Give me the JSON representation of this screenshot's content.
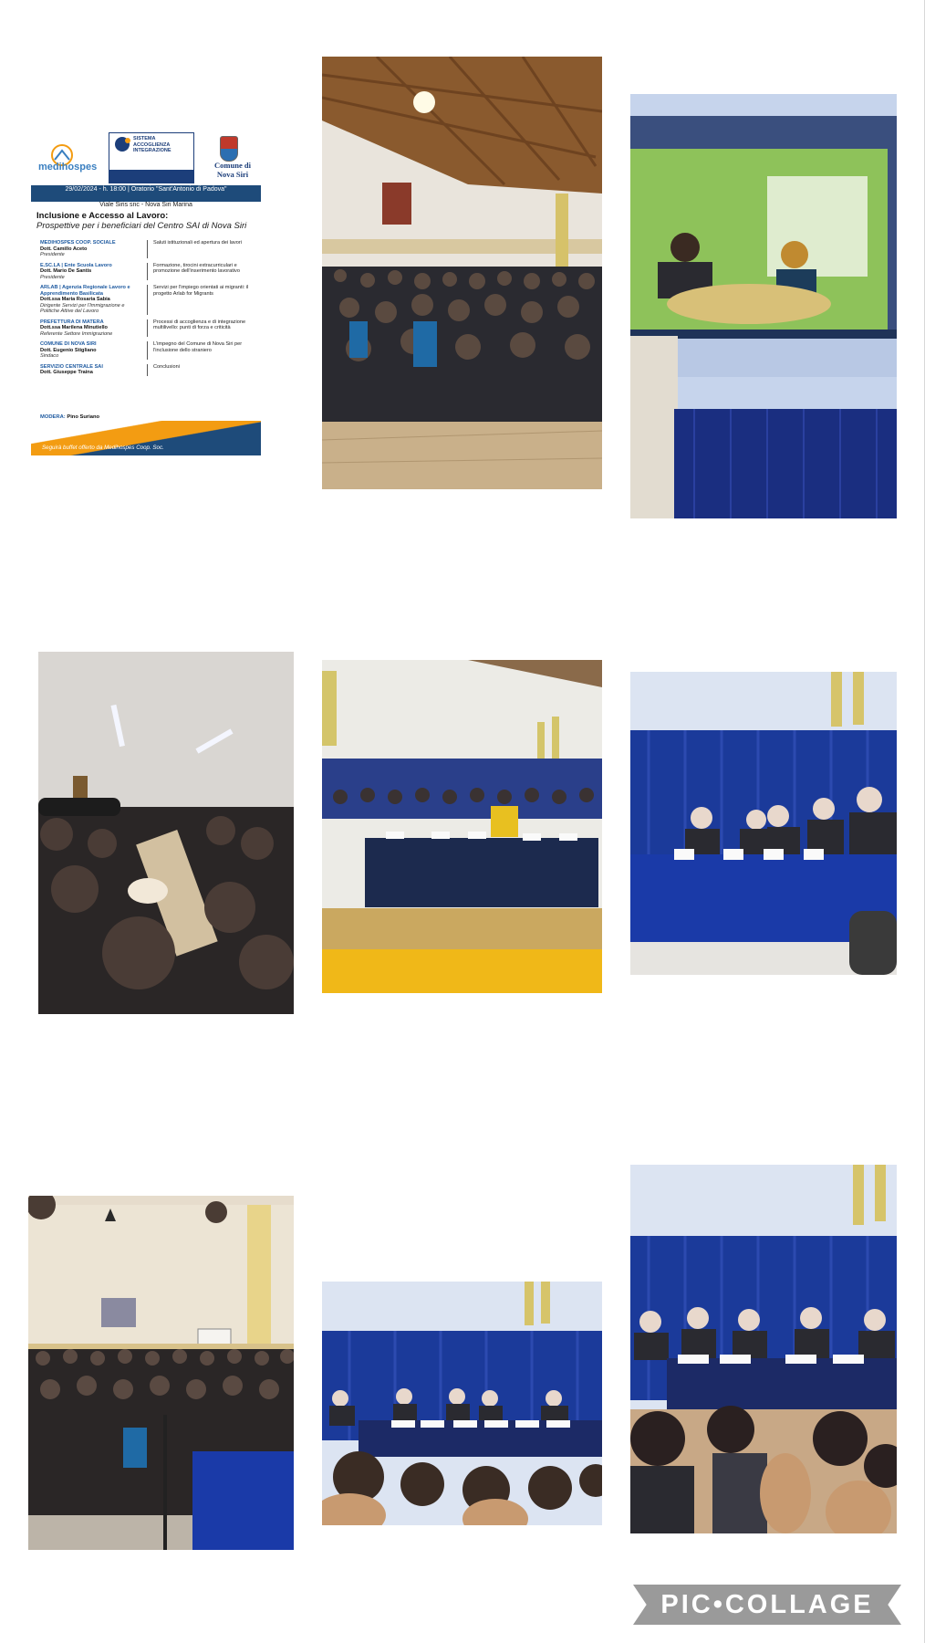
{
  "collage": {
    "badge_label": "PIC•COLLAGE"
  },
  "poster": {
    "medihospes_logo": "medihospes",
    "sai_title": "SISTEMA\nACCOGLIENZA\nINTEGRAZIONE",
    "comune_logo": "Comune di\nNova Siri",
    "event_line": "29/02/2024 - h. 18:00 | Oratorio \"Sant'Antonio di Padova\"",
    "address_line": "Viale Siris snc - Nova Siri Marina",
    "title": "Inclusione e Accesso al Lavoro:",
    "subtitle": "Prospettive per i beneficiari del Centro SAI di Nova Siri",
    "agenda": [
      {
        "org": "MEDIHOSPES COOP. SOCIALE",
        "who": "Dott. Camillo Aceto",
        "role": "Presidente",
        "topic": "Saluti istituzionali ed apertura dei lavori"
      },
      {
        "org": "E.SC.LA | Ente Scuola Lavoro",
        "who": "Dott. Mario De Santis",
        "role": "Presidente",
        "topic": "Formazione, tirocini extracurriculari e promozione dell'inserimento lavorativo"
      },
      {
        "org": "ARLAB | Agenzia Regionale Lavoro e Apprendimento Basilicata",
        "who": "Dott.ssa Maria Rosaria Sabia",
        "role": "Dirigente Servizi per l'Immigrazione e Politiche Attive del Lavoro",
        "topic": "Servizi per l'impiego orientati ai migranti: il progetto Arlab for Migrants"
      },
      {
        "org": "PREFETTURA DI MATERA",
        "who": "Dott.ssa Marilena Minutiello",
        "role": "Referente Settore Immigrazione",
        "topic": "Processi di accoglienza e di integrazione multilivello: punti di forza e criticità"
      },
      {
        "org": "COMUNE DI NOVA SIRI",
        "who": "Dott. Eugenio Stigliano",
        "role": "Sindaco",
        "topic": "L'impegno del Comune di Nova Siri per l'inclusione dello straniero"
      },
      {
        "org": "SERVIZIO CENTRALE SAI",
        "who": "Dott. Giuseppe Traina",
        "role": "",
        "topic": "Conclusioni"
      }
    ],
    "modera_label": "MODERA:",
    "modera_name": "Pino Suriano",
    "footer": "Seguirà buffet offerto da Medihospes Coop. Soc."
  }
}
